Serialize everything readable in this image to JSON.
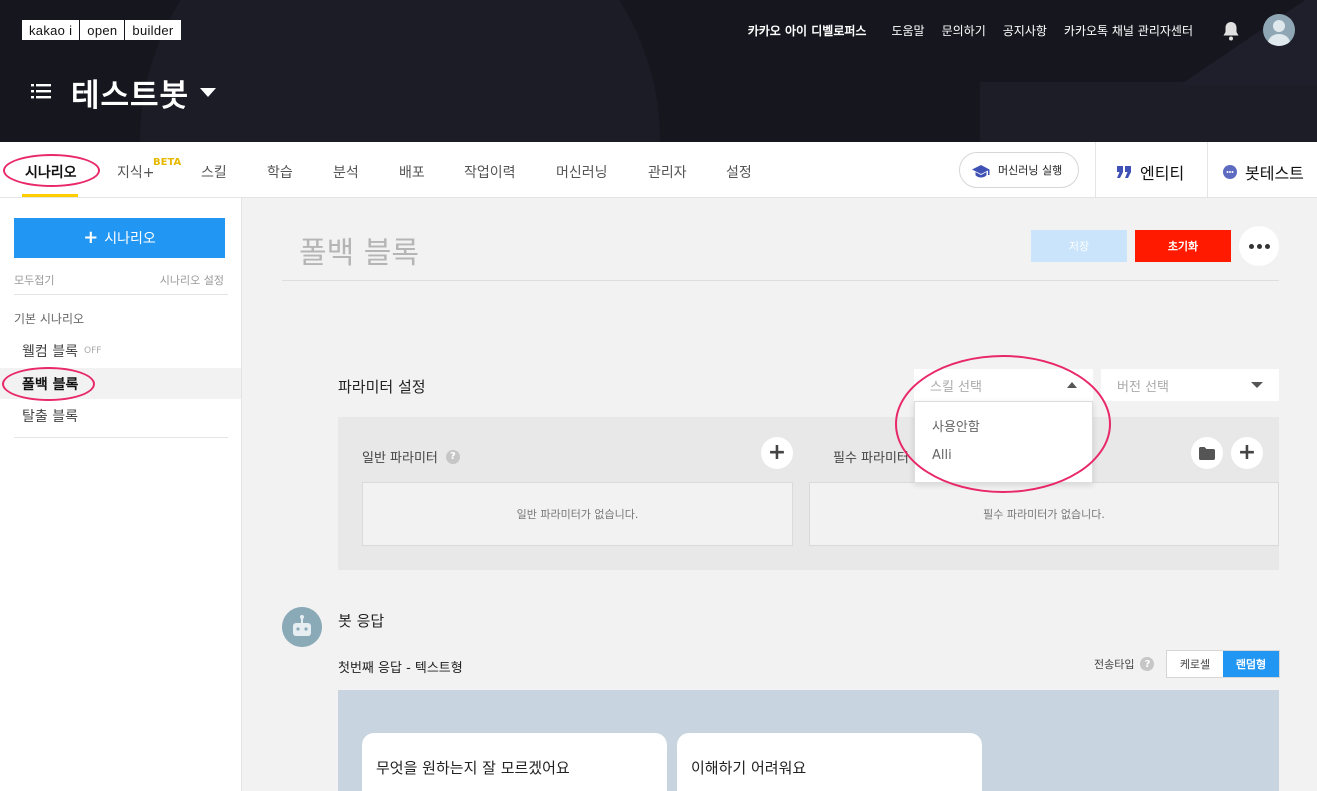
{
  "brand": {
    "logo_parts": [
      "kakao i",
      "open",
      "builder"
    ]
  },
  "top_links": {
    "developers": "카카오 아이 디벨로퍼스",
    "help": "도움말",
    "contact": "문의하기",
    "notice": "공지사항",
    "channel_admin": "카카오톡 채널 관리자센터"
  },
  "bot": {
    "name": "테스트봇"
  },
  "tabs": [
    {
      "label": "시나리오"
    },
    {
      "label": "지식+"
    },
    {
      "label": "스킬"
    },
    {
      "label": "학습"
    },
    {
      "label": "분석"
    },
    {
      "label": "배포"
    },
    {
      "label": "작업이력"
    },
    {
      "label": "머신러닝"
    },
    {
      "label": "관리자"
    },
    {
      "label": "설정"
    }
  ],
  "beta_badge": "BETA",
  "ml_run_label": "머신러닝 실행",
  "entity_label": "엔티티",
  "bottest_label": "봇테스트",
  "sidebar": {
    "add_button": "시나리오",
    "collapse_all": "모두접기",
    "scenario_settings": "시나리오 설정",
    "group_title": "기본 시나리오",
    "blocks": [
      {
        "label": "웰컴 블록",
        "badge": "OFF"
      },
      {
        "label": "폴백 블록"
      },
      {
        "label": "탈출 블록"
      }
    ]
  },
  "main": {
    "title": "폴백 블록",
    "save_label": "저장",
    "reset_label": "초기화",
    "param": {
      "title": "파라미터 설정",
      "skill_placeholder": "스킬 선택",
      "version_placeholder": "버전 선택",
      "skill_options": [
        "사용안함",
        "Alli"
      ],
      "general_label": "일반 파라미터",
      "required_label": "필수 파라미터",
      "general_empty": "일반 파라미터가 없습니다.",
      "required_empty": "필수 파라미터가 없습니다."
    },
    "response": {
      "title": "봇 응답",
      "subtitle": "첫번째 응답 - 텍스트형",
      "send_type_label": "전송타입",
      "send_types": [
        "케로셀",
        "랜덤형"
      ],
      "cards": [
        "무엇을 원하는지 잘 모르겠어요",
        "이해하기 어려워요"
      ]
    }
  },
  "colors": {
    "accent": "#2196f3",
    "danger": "#ff1a00",
    "tab_underline": "#ffcd00",
    "annotation": "#e8286a"
  }
}
